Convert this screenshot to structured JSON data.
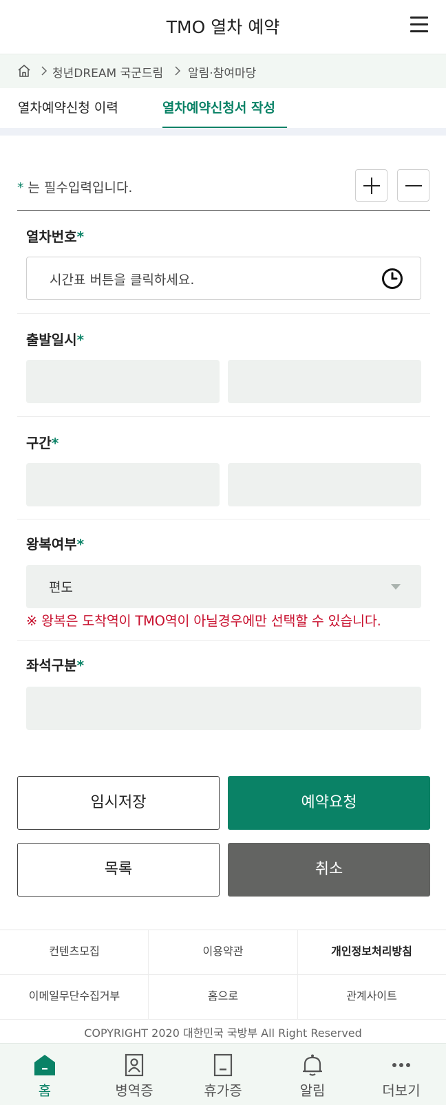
{
  "header": {
    "title": "TMO 열차 예약"
  },
  "breadcrumb": {
    "items": [
      "청년DREAM 국군드림",
      "알림·참여마당"
    ]
  },
  "tabs": [
    {
      "label": "열차예약신청 이력",
      "active": false
    },
    {
      "label": "열차예약신청서 작성",
      "active": true
    }
  ],
  "form": {
    "required_note_star": "*",
    "required_note": " 는 필수입력입니다.",
    "train_number": {
      "label": "열차번호",
      "placeholder": "시간표 버튼을 클릭하세요."
    },
    "departure": {
      "label": "출발일시",
      "date_value": "",
      "time_value": ""
    },
    "section": {
      "label": "구간",
      "from_value": "",
      "to_value": ""
    },
    "round_trip": {
      "label": "왕복여부",
      "selected": "편도",
      "notice": "※ 왕복은 도착역이 TMO역이 아닐경우에만 선택할 수 있습니다."
    },
    "seat_class": {
      "label": "좌석구분",
      "value": ""
    },
    "required_star": "*"
  },
  "buttons": {
    "temp_save": "임시저장",
    "reserve": "예약요청",
    "list": "목록",
    "cancel": "취소"
  },
  "footer": {
    "links": [
      "컨텐츠모집",
      "이용약관",
      "개인정보처리방침",
      "이메일무단수집거부",
      "홈으로",
      "관계사이트"
    ],
    "copyright": "COPYRIGHT 2020 대한민국 국방부 All Right Reserved"
  },
  "bottom_nav": [
    {
      "label": "홈",
      "icon": "home-icon",
      "active": true
    },
    {
      "label": "병역증",
      "icon": "id-card-icon",
      "active": false
    },
    {
      "label": "휴가증",
      "icon": "leave-card-icon",
      "active": false
    },
    {
      "label": "알림",
      "icon": "bell-icon",
      "active": false
    },
    {
      "label": "더보기",
      "icon": "more-icon",
      "active": false
    }
  ],
  "colors": {
    "accent": "#0a8266",
    "danger": "#c8102e",
    "dark_button": "#636462"
  }
}
